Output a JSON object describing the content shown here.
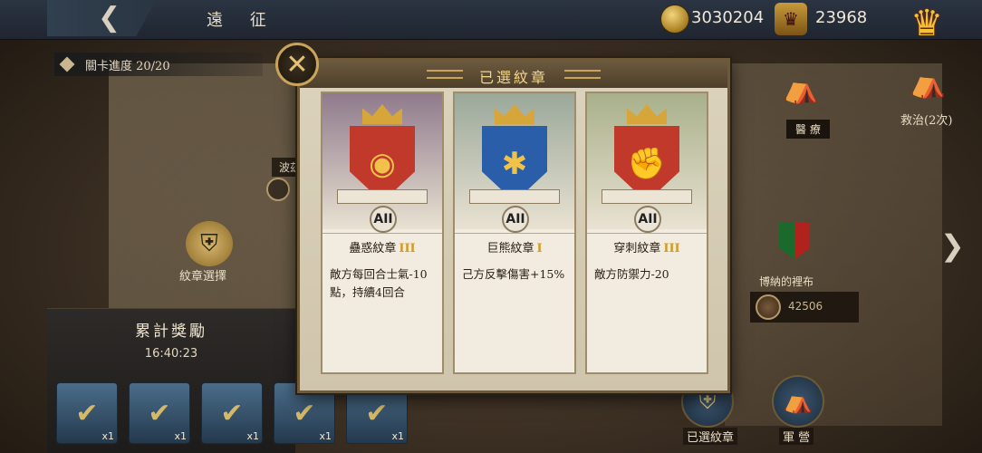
{
  "header": {
    "title": "遠 征",
    "coins": "3030204",
    "crowns": "23968"
  },
  "progress": {
    "label": "關卡進度 20/20"
  },
  "map": {
    "node_partial_label": "波茲",
    "emblem_select_label": "紋章選擇",
    "heal_label": "醫 療",
    "rescue_label": "救治(2次)",
    "enemy_name": "博納的裡布",
    "enemy_power": "42506"
  },
  "rewards": {
    "title": "累計獎勵",
    "timer": "16:40:23",
    "items": [
      {
        "icon": "catapult-icon",
        "qty": "x1"
      },
      {
        "icon": "cannon-icon",
        "qty": "x1"
      },
      {
        "icon": "map-scroll-icon",
        "qty": "x1"
      },
      {
        "icon": "siege-icon",
        "qty": "x1"
      },
      {
        "icon": "iron-ingot-icon",
        "qty": "x1"
      }
    ]
  },
  "bottom_buttons": {
    "selected_emblems": "已選紋章",
    "camp": "軍 營"
  },
  "modal": {
    "title": "已選紋章",
    "cards": [
      {
        "name": "蠱惑紋章",
        "level": "III",
        "tier": "AII",
        "desc": "敵方每回合士氣-10點，持續4回合",
        "banner_color": "#8f7a8c",
        "shield_color": "#c0392b",
        "emblem": "eye-emblem"
      },
      {
        "name": "巨熊紋章",
        "level": "I",
        "tier": "AII",
        "desc": "己方反擊傷害+15%",
        "banner_color": "#9aa89a",
        "shield_color": "#2a5ea8",
        "emblem": "bear-emblem"
      },
      {
        "name": "穿刺紋章",
        "level": "III",
        "tier": "AII",
        "desc": "敵方防禦力-20",
        "banner_color": "#a8b08a",
        "shield_color": "#c0392b",
        "emblem": "fist-emblem"
      }
    ]
  }
}
